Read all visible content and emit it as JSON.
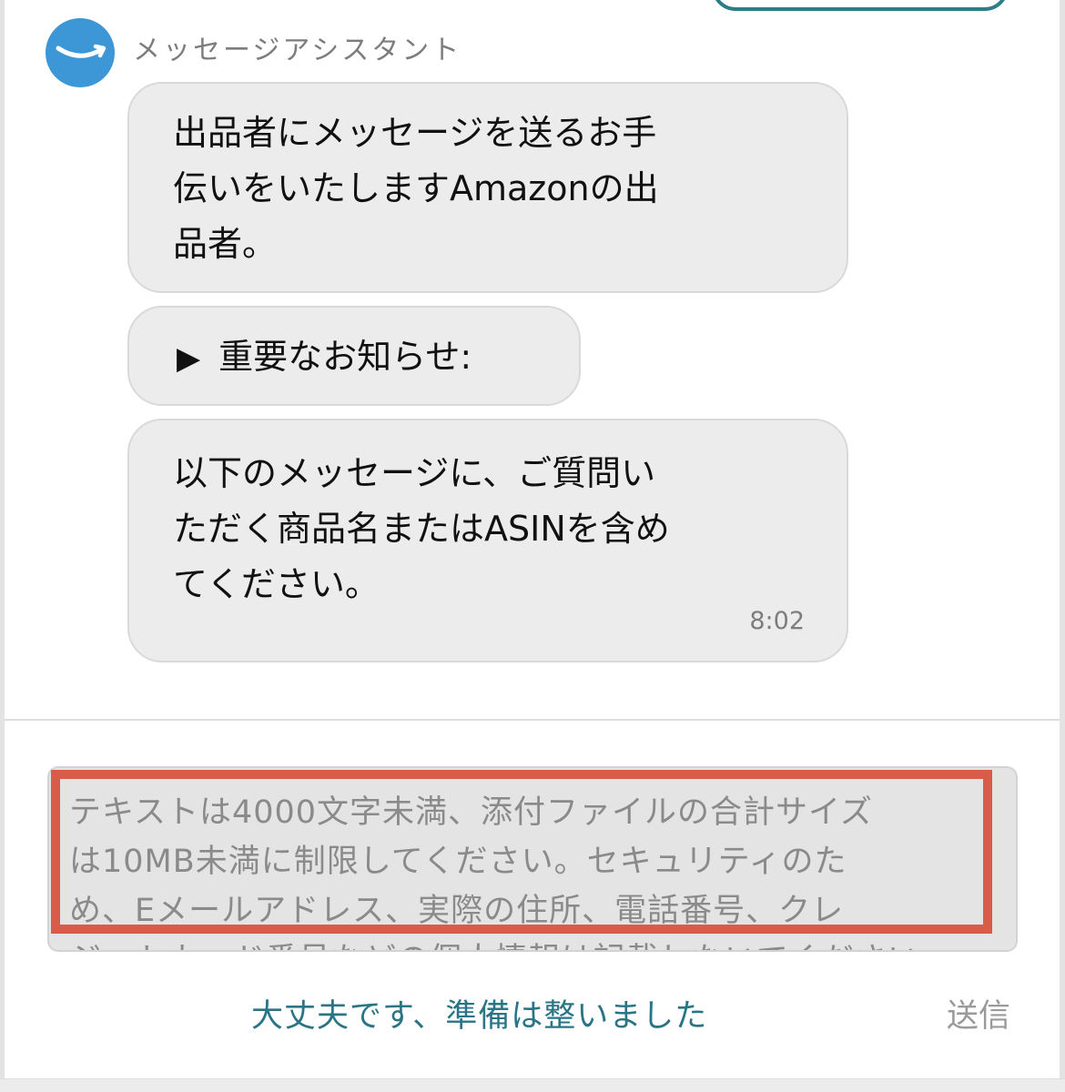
{
  "assistant": {
    "name": "メッセージアシスタント",
    "avatar_icon": "amazon-smile-logo-icon",
    "avatar_color": "#3d97d6"
  },
  "messages": [
    {
      "text_lines": [
        "出品者にメッセージを送るお手",
        "伝いをいたしますAmazonの出",
        "品者。"
      ]
    },
    {
      "text": "重要なお知らせ:",
      "expand_icon": "triangle-right-icon"
    },
    {
      "text_lines": [
        "以下のメッセージに、ご質問い",
        "ただく商品名またはASINを含め",
        "てください。"
      ],
      "time": "8:02"
    }
  ],
  "composer": {
    "placeholder_lines": [
      "テキストは4000文字未満、添付ファイルの合計サイズ",
      "は10MB未満に制限してください。セキュリティのた",
      "め、Eメールアドレス、実際の住所、電話番号、クレ",
      "ジットカード番号などの個人情報は記載しないでください。"
    ],
    "highlight_color": "#d95b4a"
  },
  "actions": {
    "quick_reply": "大丈夫です、準備は整いました",
    "send": "送信"
  },
  "colors": {
    "bubble": "#ececec",
    "link": "#2a7585",
    "muted": "#7d7d7d"
  }
}
